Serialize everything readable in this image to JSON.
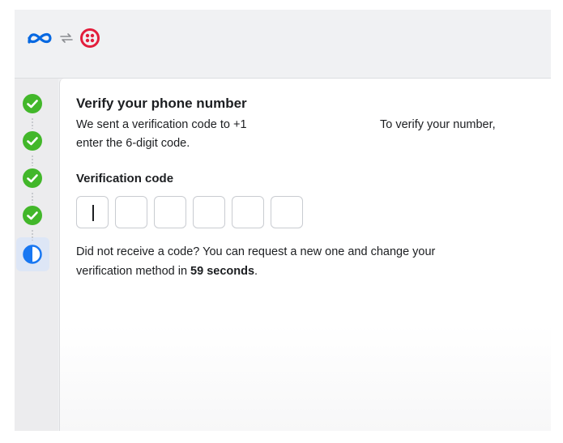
{
  "header": {
    "logos": [
      "meta-logo",
      "sync-icon",
      "twilio-logo"
    ]
  },
  "steps": [
    {
      "status": "complete",
      "icon": "check-circle-icon"
    },
    {
      "status": "complete",
      "icon": "check-circle-icon"
    },
    {
      "status": "complete",
      "icon": "check-circle-icon"
    },
    {
      "status": "complete",
      "icon": "check-circle-icon"
    },
    {
      "status": "in-progress",
      "icon": "half-circle-icon"
    }
  ],
  "main": {
    "title": "Verify your phone number",
    "description_line1_part1": "We sent a verification code to +1",
    "description_line1_part2": "To verify your number,",
    "description_line2": "enter the 6-digit code.",
    "code_label": "Verification code",
    "code_digits": [
      "",
      "",
      "",
      "",
      "",
      ""
    ],
    "resend_line1": "Did not receive a code? You can request a new one and change your",
    "resend_line2_prefix": "verification method in ",
    "resend_countdown": "59 seconds",
    "resend_line2_suffix": "."
  },
  "colors": {
    "check": "#42b72a",
    "active": "#1877f2",
    "meta": "#0668e1",
    "twilio": "#e31e3c"
  }
}
